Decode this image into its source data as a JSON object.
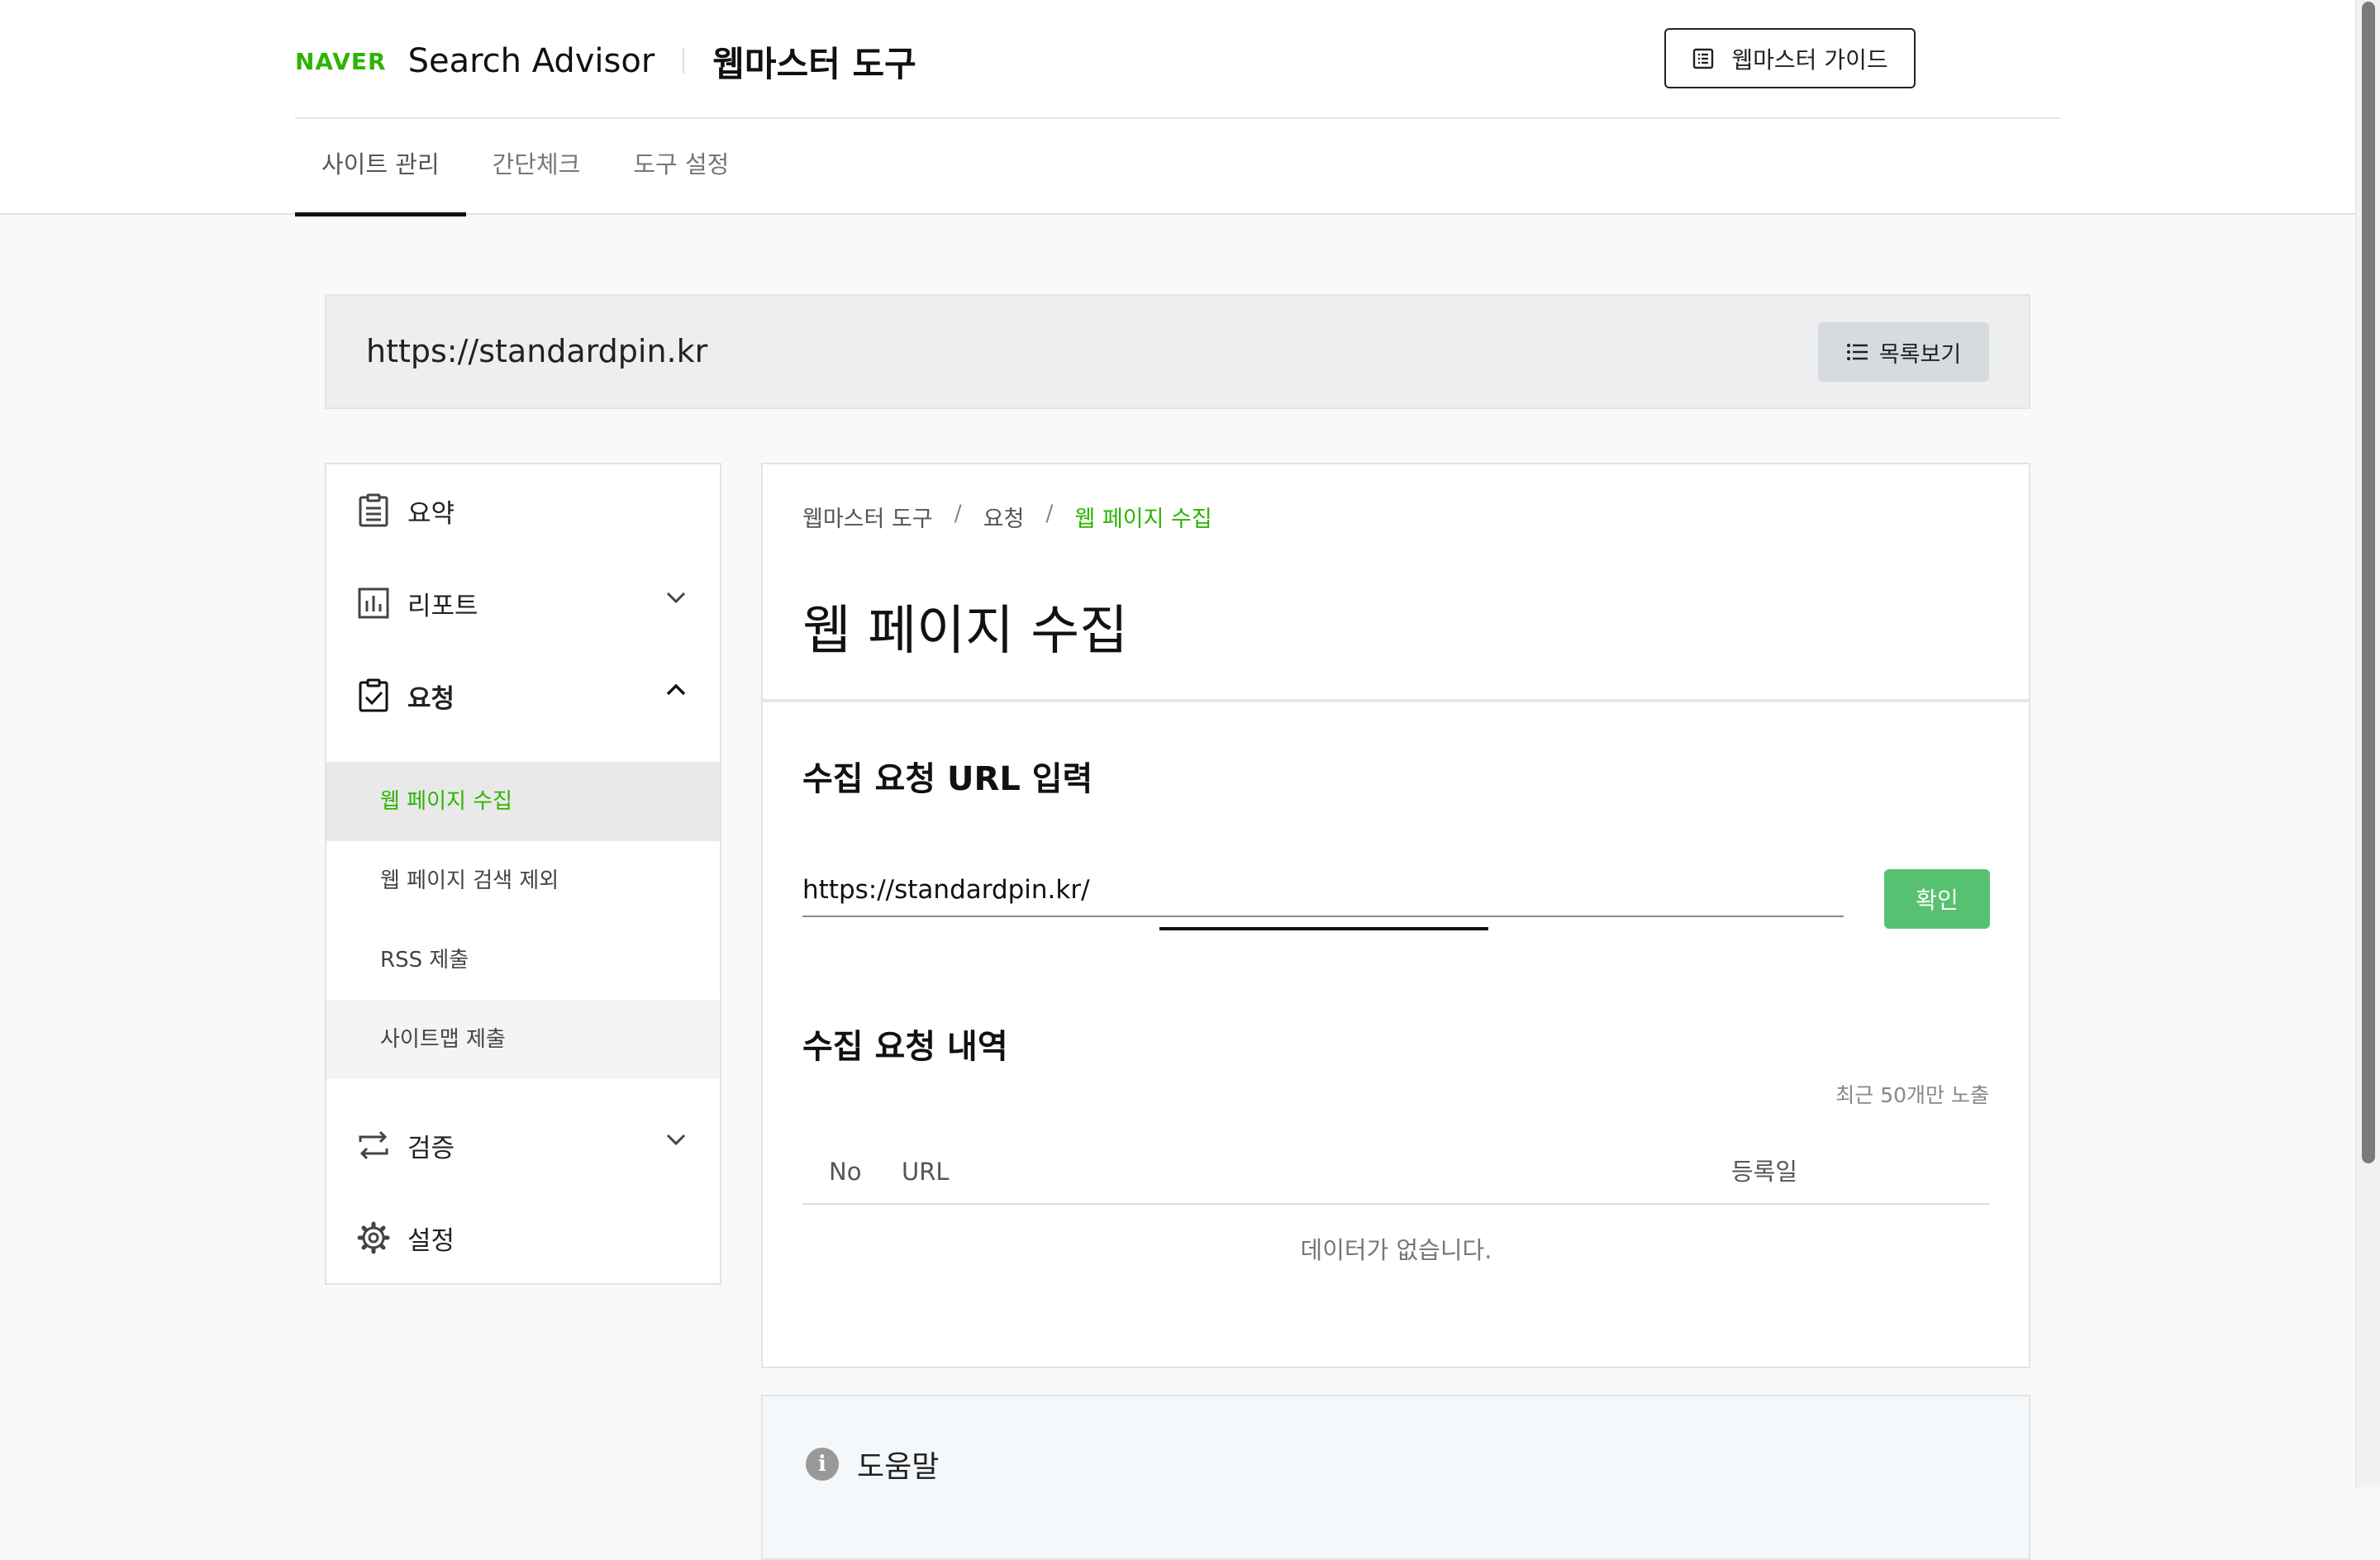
{
  "header": {
    "brand": "NAVER",
    "product": "Search Advisor",
    "product_sub": "웹마스터 도구",
    "guide_button": "웹마스터 가이드",
    "tabs": [
      {
        "label": "사이트 관리"
      },
      {
        "label": "간단체크"
      },
      {
        "label": "도구 설정"
      }
    ]
  },
  "site": {
    "url": "https://standardpin.kr",
    "list_button": "목록보기"
  },
  "sidebar": {
    "items": [
      {
        "label": "요약",
        "icon": "clipboard-list-icon"
      },
      {
        "label": "리포트",
        "icon": "bar-chart-icon"
      },
      {
        "label": "요청",
        "icon": "clipboard-check-icon"
      },
      {
        "label": "검증",
        "icon": "repeat-arrows-icon"
      },
      {
        "label": "설정",
        "icon": "gear-icon"
      }
    ],
    "sub_items": [
      {
        "label": "웹 페이지 수집"
      },
      {
        "label": "웹 페이지 검색 제외"
      },
      {
        "label": "RSS 제출"
      },
      {
        "label": "사이트맵 제출"
      }
    ]
  },
  "main": {
    "breadcrumb": [
      "웹마스터 도구",
      "요청",
      "웹 페이지 수집"
    ],
    "breadcrumb_sep": "/",
    "title": "웹 페이지 수집",
    "input_section_title": "수집 요청 URL 입력",
    "url_value": "https://standardpin.kr/",
    "confirm_button": "확인",
    "history_title": "수집 요청 내역",
    "history_note": "최근 50개만 노출",
    "table_headers": [
      "No",
      "URL",
      "등록일"
    ],
    "empty_text": "데이터가 없습니다."
  },
  "help": {
    "title": "도움말",
    "icon_glyph": "i"
  },
  "colors": {
    "accent": "#2db400",
    "button_green": "#56c271"
  }
}
